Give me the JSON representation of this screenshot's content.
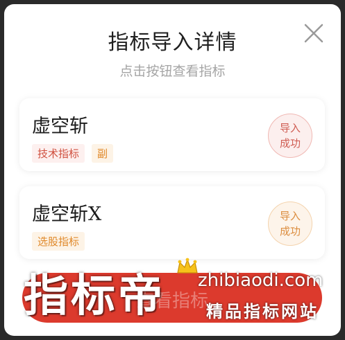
{
  "dialog": {
    "title": "指标导入详情",
    "subtitle": "点击按钮查看指标",
    "close_icon": "close-icon"
  },
  "cards": [
    {
      "name": "虚空斩",
      "tags": [
        {
          "label": "技术指标",
          "color": "#d0503f"
        },
        {
          "label": "副",
          "color": "#e0892a"
        }
      ],
      "status_line1": "导入",
      "status_line2": "成功",
      "status_color": "#cf5c52"
    },
    {
      "name": "虚空斩X",
      "tags": [
        {
          "label": "选股指标",
          "color": "#e0892a"
        }
      ],
      "status_line1": "导入",
      "status_line2": "成功",
      "status_color": "#dc8d3f"
    }
  ],
  "bottom_button": {
    "label": "查看指标"
  },
  "watermark": {
    "big_text": "指标帝",
    "url": "zhibiaodi.com",
    "slogan": "精品指标网站",
    "crown_icon": "crown-icon"
  },
  "colors": {
    "accent_red": "#dc3a2d",
    "success_red": "#cf5c52",
    "success_orange": "#dc8d3f"
  }
}
